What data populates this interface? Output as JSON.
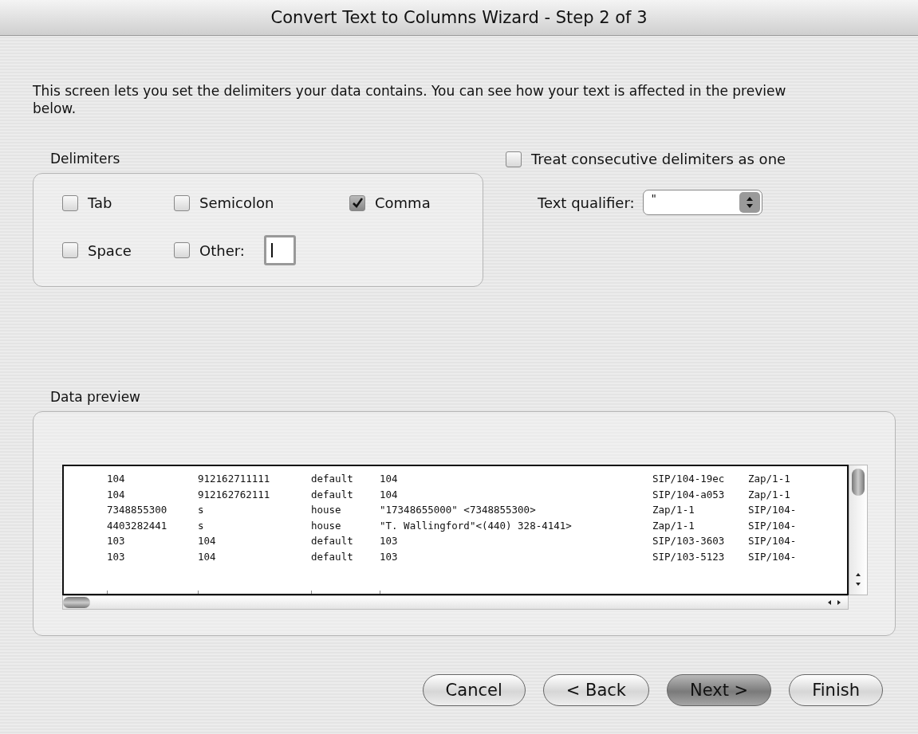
{
  "window": {
    "title": "Convert Text to Columns Wizard - Step 2 of 3"
  },
  "intro": "This screen lets you set the delimiters your data contains.  You can see how your text is affected in the preview below.",
  "delimiters": {
    "title": "Delimiters",
    "options": [
      {
        "label": "Tab",
        "checked": false
      },
      {
        "label": "Semicolon",
        "checked": false
      },
      {
        "label": "Comma",
        "checked": true
      },
      {
        "label": "Space",
        "checked": false
      },
      {
        "label": "Other:",
        "checked": false
      }
    ]
  },
  "consecutive": {
    "label": "Treat consecutive delimiters as one",
    "checked": false
  },
  "qualifier": {
    "label": "Text qualifier:",
    "value": "\""
  },
  "preview": {
    "title": "Data preview",
    "rows": [
      [
        "104",
        "912162711111",
        "default",
        "104",
        "SIP/104-19ec",
        "Zap/1-1"
      ],
      [
        "104",
        "912162762111",
        "default",
        "104",
        "SIP/104-a053",
        "Zap/1-1"
      ],
      [
        "7348855300",
        "s",
        "house",
        "\"17348655000\" <7348855300>",
        "Zap/1-1",
        "SIP/104-"
      ],
      [
        "4403282441",
        "s",
        "house",
        "\"T. Wallingford\"<(440) 328-4141>",
        "Zap/1-1",
        "SIP/104-"
      ],
      [
        "103",
        "104",
        "default",
        "103",
        "SIP/103-3603",
        "SIP/104-"
      ],
      [
        "103",
        "104",
        "default",
        "103",
        "SIP/103-5123",
        "SIP/104-"
      ]
    ]
  },
  "buttons": [
    {
      "label": "Cancel",
      "default": false
    },
    {
      "label": "< Back",
      "default": false
    },
    {
      "label": "Next >",
      "default": true
    },
    {
      "label": "Finish",
      "default": false
    }
  ]
}
